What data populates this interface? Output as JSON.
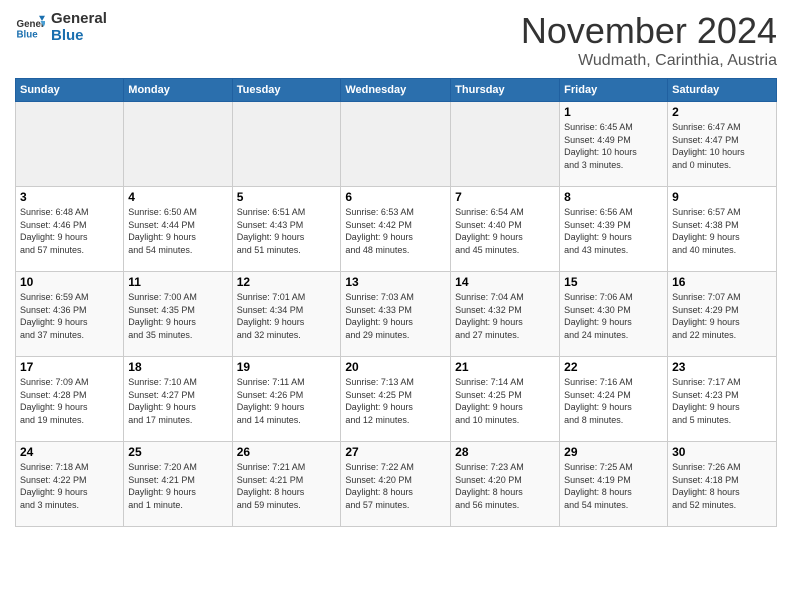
{
  "header": {
    "logo_line1": "General",
    "logo_line2": "Blue",
    "month_title": "November 2024",
    "location": "Wudmath, Carinthia, Austria"
  },
  "weekdays": [
    "Sunday",
    "Monday",
    "Tuesday",
    "Wednesday",
    "Thursday",
    "Friday",
    "Saturday"
  ],
  "weeks": [
    [
      {
        "day": "",
        "info": ""
      },
      {
        "day": "",
        "info": ""
      },
      {
        "day": "",
        "info": ""
      },
      {
        "day": "",
        "info": ""
      },
      {
        "day": "",
        "info": ""
      },
      {
        "day": "1",
        "info": "Sunrise: 6:45 AM\nSunset: 4:49 PM\nDaylight: 10 hours\nand 3 minutes."
      },
      {
        "day": "2",
        "info": "Sunrise: 6:47 AM\nSunset: 4:47 PM\nDaylight: 10 hours\nand 0 minutes."
      }
    ],
    [
      {
        "day": "3",
        "info": "Sunrise: 6:48 AM\nSunset: 4:46 PM\nDaylight: 9 hours\nand 57 minutes."
      },
      {
        "day": "4",
        "info": "Sunrise: 6:50 AM\nSunset: 4:44 PM\nDaylight: 9 hours\nand 54 minutes."
      },
      {
        "day": "5",
        "info": "Sunrise: 6:51 AM\nSunset: 4:43 PM\nDaylight: 9 hours\nand 51 minutes."
      },
      {
        "day": "6",
        "info": "Sunrise: 6:53 AM\nSunset: 4:42 PM\nDaylight: 9 hours\nand 48 minutes."
      },
      {
        "day": "7",
        "info": "Sunrise: 6:54 AM\nSunset: 4:40 PM\nDaylight: 9 hours\nand 45 minutes."
      },
      {
        "day": "8",
        "info": "Sunrise: 6:56 AM\nSunset: 4:39 PM\nDaylight: 9 hours\nand 43 minutes."
      },
      {
        "day": "9",
        "info": "Sunrise: 6:57 AM\nSunset: 4:38 PM\nDaylight: 9 hours\nand 40 minutes."
      }
    ],
    [
      {
        "day": "10",
        "info": "Sunrise: 6:59 AM\nSunset: 4:36 PM\nDaylight: 9 hours\nand 37 minutes."
      },
      {
        "day": "11",
        "info": "Sunrise: 7:00 AM\nSunset: 4:35 PM\nDaylight: 9 hours\nand 35 minutes."
      },
      {
        "day": "12",
        "info": "Sunrise: 7:01 AM\nSunset: 4:34 PM\nDaylight: 9 hours\nand 32 minutes."
      },
      {
        "day": "13",
        "info": "Sunrise: 7:03 AM\nSunset: 4:33 PM\nDaylight: 9 hours\nand 29 minutes."
      },
      {
        "day": "14",
        "info": "Sunrise: 7:04 AM\nSunset: 4:32 PM\nDaylight: 9 hours\nand 27 minutes."
      },
      {
        "day": "15",
        "info": "Sunrise: 7:06 AM\nSunset: 4:30 PM\nDaylight: 9 hours\nand 24 minutes."
      },
      {
        "day": "16",
        "info": "Sunrise: 7:07 AM\nSunset: 4:29 PM\nDaylight: 9 hours\nand 22 minutes."
      }
    ],
    [
      {
        "day": "17",
        "info": "Sunrise: 7:09 AM\nSunset: 4:28 PM\nDaylight: 9 hours\nand 19 minutes."
      },
      {
        "day": "18",
        "info": "Sunrise: 7:10 AM\nSunset: 4:27 PM\nDaylight: 9 hours\nand 17 minutes."
      },
      {
        "day": "19",
        "info": "Sunrise: 7:11 AM\nSunset: 4:26 PM\nDaylight: 9 hours\nand 14 minutes."
      },
      {
        "day": "20",
        "info": "Sunrise: 7:13 AM\nSunset: 4:25 PM\nDaylight: 9 hours\nand 12 minutes."
      },
      {
        "day": "21",
        "info": "Sunrise: 7:14 AM\nSunset: 4:25 PM\nDaylight: 9 hours\nand 10 minutes."
      },
      {
        "day": "22",
        "info": "Sunrise: 7:16 AM\nSunset: 4:24 PM\nDaylight: 9 hours\nand 8 minutes."
      },
      {
        "day": "23",
        "info": "Sunrise: 7:17 AM\nSunset: 4:23 PM\nDaylight: 9 hours\nand 5 minutes."
      }
    ],
    [
      {
        "day": "24",
        "info": "Sunrise: 7:18 AM\nSunset: 4:22 PM\nDaylight: 9 hours\nand 3 minutes."
      },
      {
        "day": "25",
        "info": "Sunrise: 7:20 AM\nSunset: 4:21 PM\nDaylight: 9 hours\nand 1 minute."
      },
      {
        "day": "26",
        "info": "Sunrise: 7:21 AM\nSunset: 4:21 PM\nDaylight: 8 hours\nand 59 minutes."
      },
      {
        "day": "27",
        "info": "Sunrise: 7:22 AM\nSunset: 4:20 PM\nDaylight: 8 hours\nand 57 minutes."
      },
      {
        "day": "28",
        "info": "Sunrise: 7:23 AM\nSunset: 4:20 PM\nDaylight: 8 hours\nand 56 minutes."
      },
      {
        "day": "29",
        "info": "Sunrise: 7:25 AM\nSunset: 4:19 PM\nDaylight: 8 hours\nand 54 minutes."
      },
      {
        "day": "30",
        "info": "Sunrise: 7:26 AM\nSunset: 4:18 PM\nDaylight: 8 hours\nand 52 minutes."
      }
    ]
  ]
}
